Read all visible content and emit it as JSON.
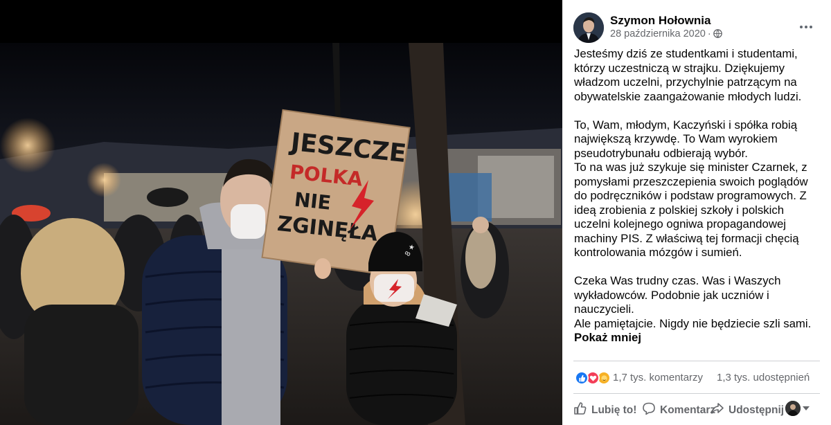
{
  "post": {
    "author": "Szymon Hołownia",
    "date": "28 października 2020",
    "privacy_icon": "globe-icon",
    "paragraphs": [
      [
        "Jesteśmy dziś ze studentkami i studentami, którzy uczestniczą w strajku. Dziękujemy władzom uczelni, przychylnie patrzącym na obywatelskie zaangażowanie młodych ludzi."
      ],
      [
        "To, Wam, młodym, Kaczyński i spółka robią największą krzywdę. To Wam wyrokiem pseudotrybunału odbierają wybór.",
        "To na was już szykuje się minister Czarnek, z pomysłami przeszczepienia swoich poglądów do podręczników i podstaw programowych. Z ideą zrobienia z polskiej szkoły i polskich uczelni kolejnego ogniwa propagandowej machiny PIS. Z właściwą tej formacji chęcią kontrolowania mózgów i sumień."
      ],
      [
        "Czeka Was trudny czas. Was i Waszych wykładowców. Podobnie jak uczniów i nauczycieli.",
        "Ale pamiętajcie. Nigdy nie będziecie szli sami."
      ]
    ],
    "show_less": "Pokaż mniej"
  },
  "photo": {
    "sign_lines": [
      "JESZCZE",
      "POLKA",
      "NIE",
      "ZGINĘŁA"
    ],
    "cap_text": "8 ★"
  },
  "stats": {
    "reaction_icons": [
      "like-icon",
      "love-icon",
      "care-icon"
    ],
    "comments": "1,7 tys. komentarzy",
    "shares": "1,3 tys. udostępnień"
  },
  "actions": {
    "like": "Lubię to!",
    "comment": "Komentarz",
    "share": "Udostępnij"
  },
  "colors": {
    "link_blue": "#1877f2",
    "love_red": "#f33e58",
    "care_yellow": "#f7b125",
    "secondary_text": "#65676b",
    "strike_red": "#d6232a"
  }
}
